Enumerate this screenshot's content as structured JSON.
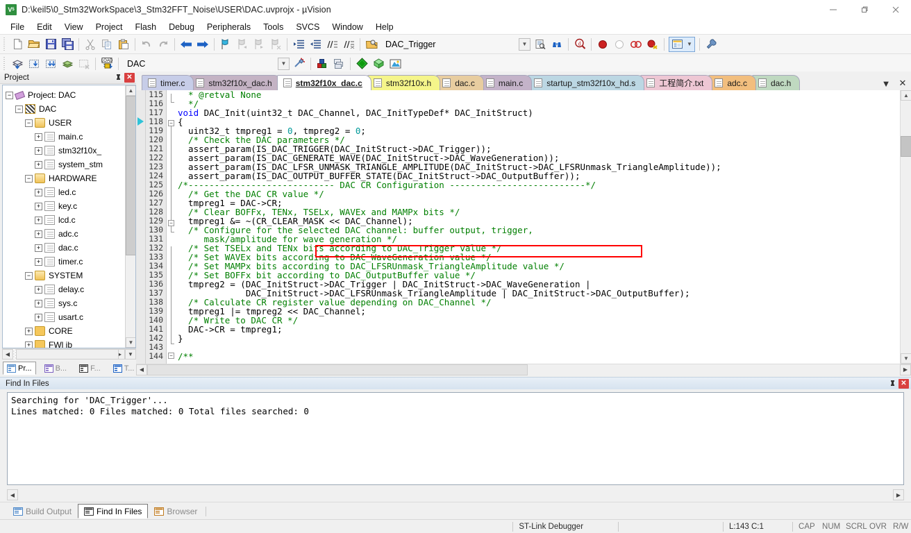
{
  "window": {
    "title": "D:\\keil5\\0_Stm32WorkSpace\\3_Stm32FFT_Noise\\USER\\DAC.uvprojx - µVision",
    "app_icon": "uvision-icon",
    "minimize": "—",
    "maximize": "❐",
    "close": "✕"
  },
  "menu": {
    "items": [
      {
        "label": "File"
      },
      {
        "label": "Edit"
      },
      {
        "label": "View"
      },
      {
        "label": "Project"
      },
      {
        "label": "Flash"
      },
      {
        "label": "Debug"
      },
      {
        "label": "Peripherals"
      },
      {
        "label": "Tools"
      },
      {
        "label": "SVCS"
      },
      {
        "label": "Window"
      },
      {
        "label": "Help"
      }
    ]
  },
  "toolbar_main": {
    "buttons": [
      {
        "name": "new-file-icon"
      },
      {
        "name": "open-file-icon"
      },
      {
        "name": "save-icon"
      },
      {
        "name": "save-all-icon"
      },
      {
        "name": "cut-icon"
      },
      {
        "name": "copy-icon"
      },
      {
        "name": "paste-icon"
      },
      {
        "name": "undo-icon"
      },
      {
        "name": "redo-icon"
      },
      {
        "name": "navigate-back-icon"
      },
      {
        "name": "navigate-forward-icon"
      },
      {
        "name": "bookmark-toggle-icon"
      },
      {
        "name": "bookmark-prev-icon"
      },
      {
        "name": "bookmark-next-icon"
      },
      {
        "name": "bookmark-clear-icon"
      },
      {
        "name": "indent-icon"
      },
      {
        "name": "outdent-icon"
      },
      {
        "name": "comment-icon"
      },
      {
        "name": "uncomment-icon"
      }
    ],
    "search_combo_value": "DAC_Trigger",
    "search_combo_placeholder": "",
    "after_search_buttons": [
      {
        "name": "find-in-files-icon"
      },
      {
        "name": "binoculars-icon"
      },
      {
        "name": "browse-symbol-icon"
      }
    ],
    "debug_buttons": [
      {
        "name": "insert-breakpoint-icon"
      },
      {
        "name": "disable-breakpoint-icon"
      },
      {
        "name": "kill-all-breakpoints-icon"
      },
      {
        "name": "disable-all-breakpoints-icon"
      },
      {
        "name": "manage-windows-icon"
      },
      {
        "name": "configure-icon"
      }
    ]
  },
  "toolbar_build": {
    "buttons": [
      {
        "name": "translate-icon"
      },
      {
        "name": "build-icon"
      },
      {
        "name": "rebuild-icon"
      },
      {
        "name": "batch-build-icon"
      },
      {
        "name": "stop-build-icon"
      },
      {
        "name": "download-icon"
      }
    ],
    "target_value": "DAC",
    "after_buttons": [
      {
        "name": "target-options-icon"
      },
      {
        "name": "manage-project-items-icon"
      },
      {
        "name": "manage-multi-project-icon"
      },
      {
        "name": "pack-installer-icon"
      },
      {
        "name": "manage-run-time-env-icon"
      },
      {
        "name": "select-software-packs-icon"
      }
    ]
  },
  "project_panel": {
    "title": "Project",
    "pin_icon": "pin-icon",
    "close_icon": "close-icon",
    "tree": [
      {
        "label": "Project: DAC",
        "depth": 0,
        "toggle": "-",
        "icon": "project-icon"
      },
      {
        "label": "DAC",
        "depth": 1,
        "toggle": "-",
        "icon": "target-folder-icon"
      },
      {
        "label": "USER",
        "depth": 2,
        "toggle": "-",
        "icon": "group-folder-icon"
      },
      {
        "label": "main.c",
        "depth": 3,
        "toggle": "+",
        "icon": "c-file-icon"
      },
      {
        "label": "stm32f10x_",
        "depth": 3,
        "toggle": "+",
        "icon": "c-file-icon"
      },
      {
        "label": "system_stm",
        "depth": 3,
        "toggle": "+",
        "icon": "c-file-icon"
      },
      {
        "label": "HARDWARE",
        "depth": 2,
        "toggle": "-",
        "icon": "group-folder-icon"
      },
      {
        "label": "led.c",
        "depth": 3,
        "toggle": "+",
        "icon": "c-file-icon"
      },
      {
        "label": "key.c",
        "depth": 3,
        "toggle": "+",
        "icon": "c-file-icon"
      },
      {
        "label": "lcd.c",
        "depth": 3,
        "toggle": "+",
        "icon": "c-file-icon"
      },
      {
        "label": "adc.c",
        "depth": 3,
        "toggle": "+",
        "icon": "c-file-icon"
      },
      {
        "label": "dac.c",
        "depth": 3,
        "toggle": "+",
        "icon": "c-file-icon"
      },
      {
        "label": "timer.c",
        "depth": 3,
        "toggle": "+",
        "icon": "c-file-icon"
      },
      {
        "label": "SYSTEM",
        "depth": 2,
        "toggle": "-",
        "icon": "group-folder-icon"
      },
      {
        "label": "delay.c",
        "depth": 3,
        "toggle": "+",
        "icon": "c-file-icon"
      },
      {
        "label": "sys.c",
        "depth": 3,
        "toggle": "+",
        "icon": "c-file-icon"
      },
      {
        "label": "usart.c",
        "depth": 3,
        "toggle": "+",
        "icon": "c-file-icon"
      },
      {
        "label": "CORE",
        "depth": 2,
        "toggle": "+",
        "icon": "group-folder-closed-icon"
      },
      {
        "label": "FWl ib",
        "depth": 2,
        "toggle": "+",
        "icon": "group-folder-closed-icon"
      }
    ],
    "tabs": [
      {
        "label": "Pr...",
        "icon": "project-tab-icon",
        "active": true
      },
      {
        "label": "B...",
        "icon": "books-tab-icon",
        "active": false
      },
      {
        "label": "F...",
        "icon": "functions-tab-icon",
        "active": false
      },
      {
        "label": "T...",
        "icon": "templates-tab-icon",
        "active": false
      }
    ]
  },
  "editor": {
    "tabs": [
      {
        "label": "timer.c",
        "color": "#c7cde8",
        "active": false
      },
      {
        "label": "stm32f10x_dac.h",
        "color": "#c4b3c4",
        "active": false
      },
      {
        "label": "stm32f10x_dac.c",
        "color": "#ffffff",
        "active": true
      },
      {
        "label": "stm32f10x.h",
        "color": "#f5f58a",
        "active": false
      },
      {
        "label": "dac.c",
        "color": "#e8cda0",
        "active": false
      },
      {
        "label": "main.c",
        "color": "#c4b3c9",
        "active": false
      },
      {
        "label": "startup_stm32f10x_hd.s",
        "color": "#bcd7e3",
        "active": false
      },
      {
        "label": "工程简介.txt",
        "color": "#eec7d4",
        "active": false
      },
      {
        "label": "adc.c",
        "color": "#f2be7e",
        "active": false
      },
      {
        "label": "dac.h",
        "color": "#bfd9c0",
        "active": false
      }
    ],
    "tab_list_icon": "tab-list-icon",
    "tab_close_icon": "tab-close-icon",
    "first_line_number": 115,
    "lines": [
      {
        "n": 115,
        "segs": [
          {
            "t": "  * @retval None",
            "c": "cm"
          }
        ]
      },
      {
        "n": 116,
        "segs": [
          {
            "t": "  */",
            "c": "cm"
          }
        ]
      },
      {
        "n": 117,
        "segs": [
          {
            "t": "void ",
            "c": "kw"
          },
          {
            "t": "DAC_Init(uint32_t DAC_Channel, DAC_InitTypeDef* DAC_InitStruct)",
            "c": ""
          }
        ]
      },
      {
        "n": 118,
        "segs": [
          {
            "t": "{",
            "c": ""
          }
        ]
      },
      {
        "n": 119,
        "segs": [
          {
            "t": "  uint32_t tmpreg1 = ",
            "c": ""
          },
          {
            "t": "0",
            "c": "num"
          },
          {
            "t": ", tmpreg2 = ",
            "c": ""
          },
          {
            "t": "0",
            "c": "num"
          },
          {
            "t": ";",
            "c": ""
          }
        ]
      },
      {
        "n": 120,
        "segs": [
          {
            "t": "  /* Check the DAC parameters */",
            "c": "cm"
          }
        ]
      },
      {
        "n": 121,
        "segs": [
          {
            "t": "  assert_param(IS_DAC_TRIGGER(DAC_InitStruct->DAC_Trigger));",
            "c": ""
          }
        ]
      },
      {
        "n": 122,
        "segs": [
          {
            "t": "  assert_param(IS_DAC_GENERATE_WAVE(DAC_InitStruct->DAC_WaveGeneration));",
            "c": ""
          }
        ]
      },
      {
        "n": 123,
        "segs": [
          {
            "t": "  assert_param(IS_DAC_LFSR_UNMASK_TRIANGLE_AMPLITUDE(DAC_InitStruct->DAC_LFSRUnmask_TriangleAmplitude));",
            "c": ""
          }
        ]
      },
      {
        "n": 124,
        "segs": [
          {
            "t": "  assert_param(IS_DAC_OUTPUT_BUFFER_STATE(DAC_InitStruct->DAC_OutputBuffer));",
            "c": ""
          }
        ]
      },
      {
        "n": 125,
        "segs": [
          {
            "t": "/*---------------------------- DAC CR Configuration --------------------------*/",
            "c": "cm"
          }
        ]
      },
      {
        "n": 126,
        "segs": [
          {
            "t": "  /* Get the DAC CR value */",
            "c": "cm"
          }
        ]
      },
      {
        "n": 127,
        "segs": [
          {
            "t": "  tmpreg1 = DAC->CR;",
            "c": ""
          }
        ]
      },
      {
        "n": 128,
        "segs": [
          {
            "t": "  /* Clear BOFFx, TENx, TSELx, WAVEx and MAMPx bits */",
            "c": "cm"
          }
        ]
      },
      {
        "n": 129,
        "segs": [
          {
            "t": "  tmpreg1 &= ~(CR_CLEAR_MASK << DAC_Channel);",
            "c": ""
          }
        ]
      },
      {
        "n": 130,
        "segs": [
          {
            "t": "  /* Configure for the selected DAC channel: buffer output, trigger,",
            "c": "cm"
          }
        ]
      },
      {
        "n": 131,
        "segs": [
          {
            "t": "     mask/amplitude for wave generation */",
            "c": "cm"
          }
        ]
      },
      {
        "n": 132,
        "segs": [
          {
            "t": "  /* Set TSELx and TENx bits according to DAC_Trigger value */",
            "c": "cm"
          }
        ]
      },
      {
        "n": 133,
        "segs": [
          {
            "t": "  /* Set WAVEx bits according to DAC_WaveGeneration value */",
            "c": "cm"
          }
        ]
      },
      {
        "n": 134,
        "segs": [
          {
            "t": "  /* Set MAMPx bits according to DAC_LFSRUnmask_TriangleAmplitude value */",
            "c": "cm"
          }
        ]
      },
      {
        "n": 135,
        "segs": [
          {
            "t": "  /* Set BOFFx bit according to DAC_OutputBuffer value */",
            "c": "cm"
          }
        ]
      },
      {
        "n": 136,
        "segs": [
          {
            "t": "  tmpreg2 = (DAC_InitStruct->DAC_Trigger | DAC_InitStruct->DAC_WaveGeneration |",
            "c": ""
          }
        ]
      },
      {
        "n": 137,
        "segs": [
          {
            "t": "             DAC_InitStruct->DAC_LFSRUnmask_TriangleAmplitude | DAC_InitStruct->DAC_OutputBuffer);",
            "c": ""
          }
        ]
      },
      {
        "n": 138,
        "segs": [
          {
            "t": "  /* Calculate CR register value depending on DAC_Channel */",
            "c": "cm"
          }
        ]
      },
      {
        "n": 139,
        "segs": [
          {
            "t": "  tmpreg1 |= tmpreg2 << DAC_Channel;",
            "c": ""
          }
        ]
      },
      {
        "n": 140,
        "segs": [
          {
            "t": "  /* Write to DAC CR */",
            "c": "cm"
          }
        ]
      },
      {
        "n": 141,
        "segs": [
          {
            "t": "  DAC->CR = tmpreg1;",
            "c": ""
          }
        ]
      },
      {
        "n": 142,
        "segs": [
          {
            "t": "}",
            "c": ""
          }
        ]
      },
      {
        "n": 143,
        "segs": [
          {
            "t": "",
            "c": ""
          }
        ]
      },
      {
        "n": 144,
        "segs": [
          {
            "t": "/**",
            "c": "cm"
          }
        ]
      }
    ],
    "highlights": [
      {
        "name": "highlight-box-line-132",
        "color": "#ff0000"
      },
      {
        "name": "highlight-box-dac-trigger",
        "color": "#ff0000"
      }
    ],
    "current_line_marker": "execution-arrow"
  },
  "find_in_files": {
    "title": "Find In Files",
    "pin_icon": "pin-icon",
    "close_icon": "close-icon",
    "lines": [
      "Searching for 'DAC_Trigger'...",
      "Lines matched: 0       Files matched: 0       Total files searched: 0"
    ]
  },
  "bottom_tabs": [
    {
      "label": "Build Output",
      "icon": "build-output-icon",
      "active": false
    },
    {
      "label": "Find In Files",
      "icon": "find-in-files-icon",
      "active": true
    },
    {
      "label": "Browser",
      "icon": "browser-icon",
      "active": false
    }
  ],
  "statusbar": {
    "message": "",
    "debugger": "ST-Link Debugger",
    "position": "L:143 C:1",
    "flags": [
      "CAP",
      "NUM",
      "SCRL",
      "OVR",
      "R/W"
    ]
  },
  "colors": {
    "accent": "#3a6ea5",
    "comment_green": "#007f00",
    "keyword_blue": "#0000ff",
    "number_teal": "#009999",
    "highlight_red": "#ff0000",
    "panel_bg": "#f0f0f0"
  }
}
